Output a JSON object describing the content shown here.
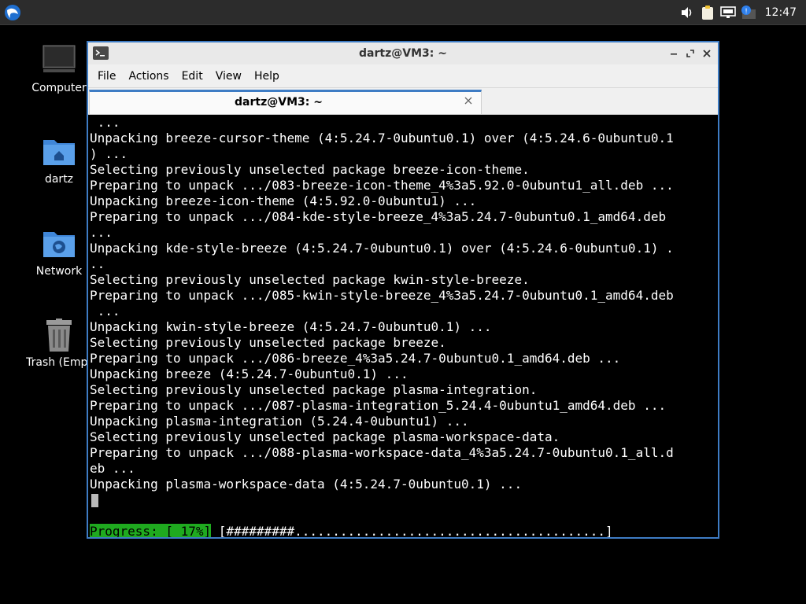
{
  "panel": {
    "clock": "12:47",
    "icons": [
      "volume-icon",
      "clipboard-icon",
      "network-icon",
      "update-notifier-icon"
    ]
  },
  "desktop": {
    "icons": [
      {
        "label": "Computer",
        "icon": "computer-icon"
      },
      {
        "label": "dartz",
        "icon": "home-folder-icon"
      },
      {
        "label": "Network",
        "icon": "network-folder-icon"
      },
      {
        "label": "Trash (Empt",
        "icon": "trash-icon"
      }
    ]
  },
  "window": {
    "title": "dartz@VM3: ~",
    "menu": [
      "File",
      "Actions",
      "Edit",
      "View",
      "Help"
    ],
    "tab": {
      "label": "dartz@VM3: ~"
    }
  },
  "terminal": {
    "lines": [
      " ...",
      "Unpacking breeze-cursor-theme (4:5.24.7-0ubuntu0.1) over (4:5.24.6-0ubuntu0.1",
      ") ...",
      "Selecting previously unselected package breeze-icon-theme.",
      "Preparing to unpack .../083-breeze-icon-theme_4%3a5.92.0-0ubuntu1_all.deb ...",
      "Unpacking breeze-icon-theme (4:5.92.0-0ubuntu1) ...",
      "Preparing to unpack .../084-kde-style-breeze_4%3a5.24.7-0ubuntu0.1_amd64.deb",
      "...",
      "Unpacking kde-style-breeze (4:5.24.7-0ubuntu0.1) over (4:5.24.6-0ubuntu0.1) .",
      "..",
      "Selecting previously unselected package kwin-style-breeze.",
      "Preparing to unpack .../085-kwin-style-breeze_4%3a5.24.7-0ubuntu0.1_amd64.deb",
      " ...",
      "Unpacking kwin-style-breeze (4:5.24.7-0ubuntu0.1) ...",
      "Selecting previously unselected package breeze.",
      "Preparing to unpack .../086-breeze_4%3a5.24.7-0ubuntu0.1_amd64.deb ...",
      "Unpacking breeze (4:5.24.7-0ubuntu0.1) ...",
      "Selecting previously unselected package plasma-integration.",
      "Preparing to unpack .../087-plasma-integration_5.24.4-0ubuntu1_amd64.deb ...",
      "Unpacking plasma-integration (5.24.4-0ubuntu1) ...",
      "Selecting previously unselected package plasma-workspace-data.",
      "Preparing to unpack .../088-plasma-workspace-data_4%3a5.24.7-0ubuntu0.1_all.d",
      "eb ...",
      "Unpacking plasma-workspace-data (4:5.24.7-0ubuntu0.1) ..."
    ],
    "progress_label": "Progress: [ 17%]",
    "progress_bar": " [#########.........................................]",
    "progress_percent": 17
  },
  "colors": {
    "accent": "#3e7cc4",
    "progress_green": "#1faa1f",
    "panel_bg": "#2c2c2c"
  }
}
